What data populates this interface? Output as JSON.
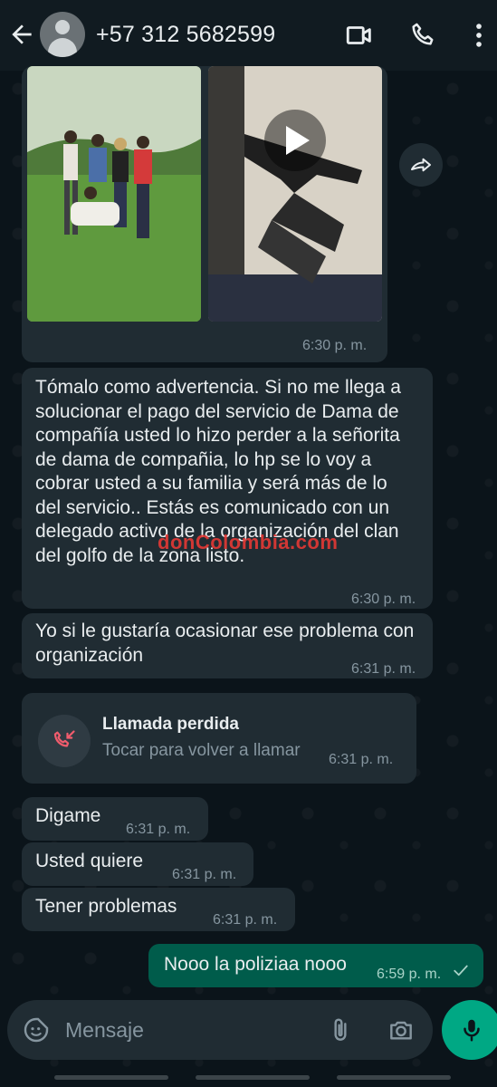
{
  "header": {
    "contact": "+57 312 5682599"
  },
  "media": {
    "time": "6:30 p. m."
  },
  "messages": [
    {
      "text": "Tómalo como advertencia.  Si no me llega a solucionar el pago del servicio de Dama de compañía usted lo hizo perder a la señorita de dama  de compañia,  lo hp se lo voy a cobrar  usted a su familia y será más de lo del servicio.. Estás es comunicado con un delegado activo de la organización del clan del golfo de la zona listo.",
      "time": "6:30 p. m."
    },
    {
      "text": "Yo si le gustaría ocasionar ese problema con organización",
      "time": "6:31 p. m."
    },
    {
      "text": "Digame",
      "time": "6:31 p. m."
    },
    {
      "text": "Usted quiere",
      "time": "6:31 p. m."
    },
    {
      "text": "Tener problemas",
      "time": "6:31 p. m."
    },
    {
      "text": "Nooo la poliziaa nooo",
      "time": "6:59 p. m."
    }
  ],
  "missed_call": {
    "title": "Llamada perdida",
    "subtitle": "Tocar para volver a llamar",
    "time": "6:31 p. m."
  },
  "watermark": "donColombia.com",
  "input": {
    "placeholder": "Mensaje"
  },
  "colors": {
    "header": "#111b21",
    "incoming_bubble": "#202c33",
    "outgoing_bubble": "#005c4b",
    "accent": "#00a884",
    "missed_call_red": "#f15c6d"
  }
}
